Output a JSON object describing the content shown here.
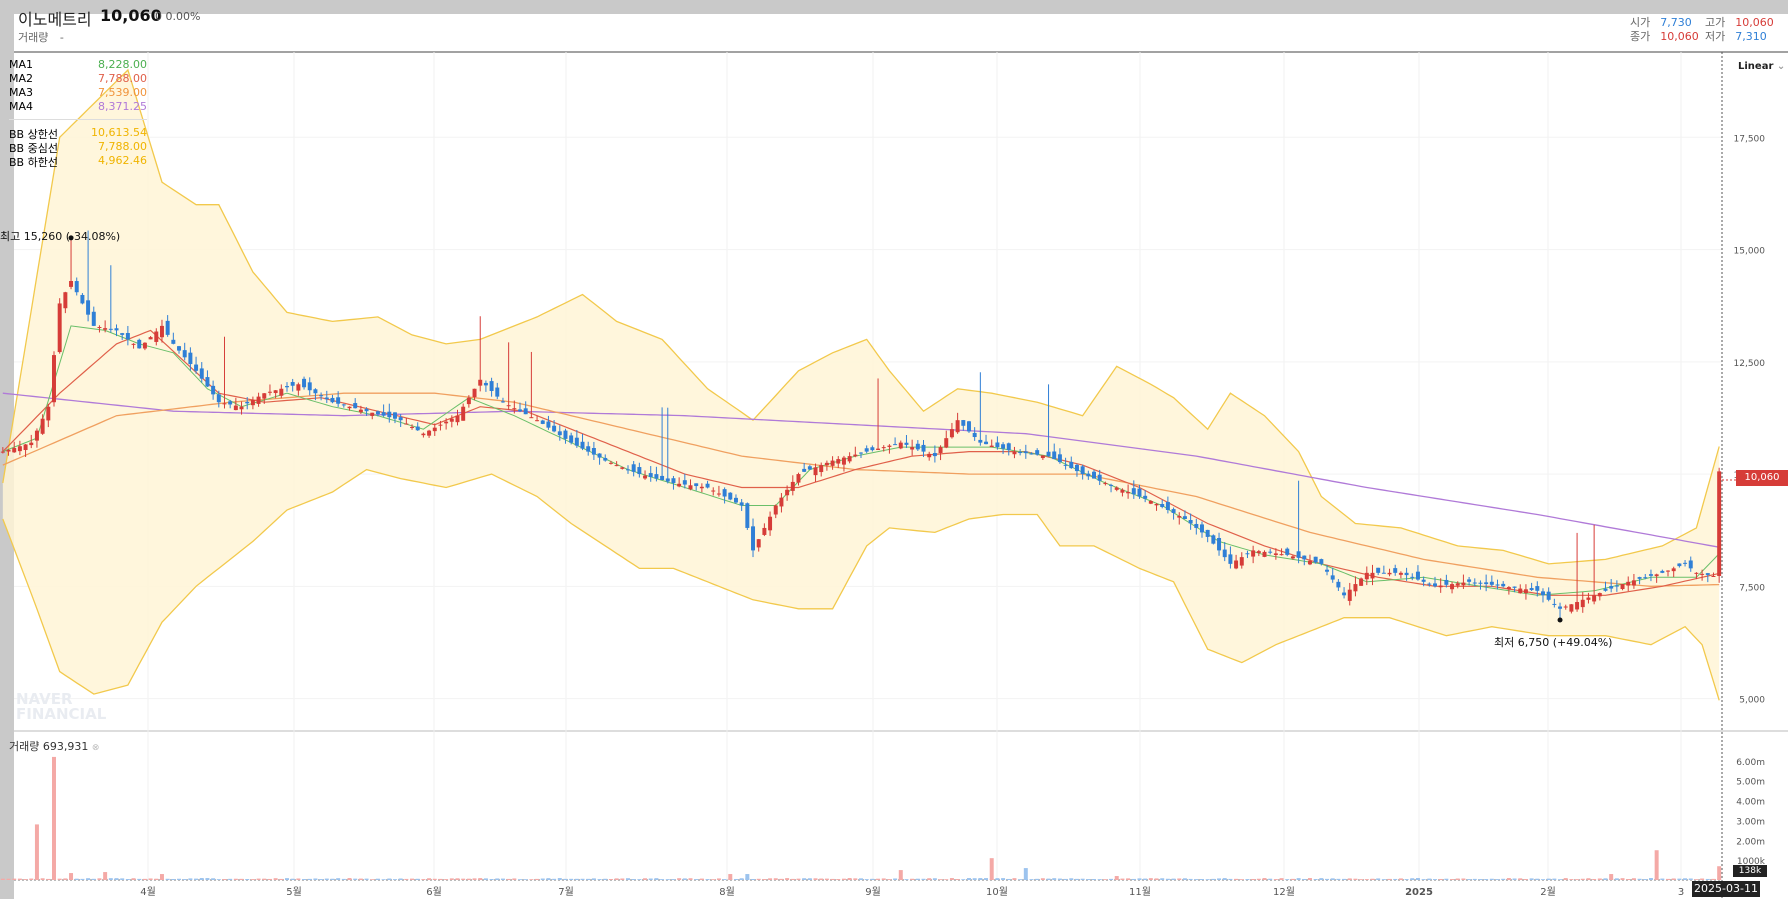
{
  "header": {
    "name": "이노메트리",
    "price": "10,060",
    "change": "0 0.00%",
    "volume_label": "거래량",
    "volume_value": "-"
  },
  "ohlc": {
    "open_label": "시가",
    "open": "7,730",
    "high_label": "고가",
    "high": "10,060",
    "close_label": "종가",
    "close": "10,060",
    "low_label": "저가",
    "low": "7,310"
  },
  "legend": {
    "ma": [
      {
        "name": "MA1",
        "value": "8,228.00",
        "color": "#4caf50"
      },
      {
        "name": "MA2",
        "value": "7,788.00",
        "color": "#e0604a"
      },
      {
        "name": "MA3",
        "value": "7,539.00",
        "color": "#f0943c"
      },
      {
        "name": "MA4",
        "value": "8,371.25",
        "color": "#b07ad8"
      }
    ],
    "bb": [
      {
        "name": "BB 상한선",
        "value": "10,613.54",
        "color": "#f2c037"
      },
      {
        "name": "BB 중심선",
        "value": "7,788.00",
        "color": "#f2c037"
      },
      {
        "name": "BB 하한선",
        "value": "4,962.46",
        "color": "#f2c037"
      }
    ]
  },
  "scale_mode": "Linear",
  "annotations": {
    "high": "최고 15,260 (-34.08%)",
    "low": "최저 6,750 (+49.04%)"
  },
  "watermark": [
    "NAVER",
    "FINANCIAL"
  ],
  "volume_panel": {
    "label": "거래량",
    "value": "693,931"
  },
  "current_price_tag": "10,060",
  "current_volume_tag": "138k",
  "crosshair_date": "2025-03-11",
  "colors": {
    "up": "#d63c38",
    "down": "#2f7fd6",
    "band_fill": "#fff5d6",
    "band_line": "#f2c94c"
  },
  "chart_data": {
    "type": "candlestick",
    "y_ticks": [
      "17,500",
      "15,000",
      "12,500",
      "10,000",
      "7,500",
      "5,000"
    ],
    "y_tick_values": [
      17500,
      15000,
      12500,
      10000,
      7500,
      5000
    ],
    "ylim": [
      4300,
      19400
    ],
    "x_labels": [
      "4월",
      "5월",
      "6월",
      "7월",
      "8월",
      "9월",
      "10월",
      "11월",
      "12월",
      "2025",
      "2월",
      "3"
    ],
    "volume_ticks": [
      "6.00m",
      "5.00m",
      "4.00m",
      "3.00m",
      "2.00m",
      "1000k"
    ],
    "volume_tick_values": [
      6000000,
      5000000,
      4000000,
      3000000,
      2000000,
      1000000
    ],
    "price_anchors": [
      [
        0,
        10500
      ],
      [
        5,
        10700
      ],
      [
        8,
        11500
      ],
      [
        10,
        13800
      ],
      [
        12,
        14300
      ],
      [
        14,
        13800
      ],
      [
        16,
        13300
      ],
      [
        20,
        13200
      ],
      [
        24,
        12800
      ],
      [
        28,
        13300
      ],
      [
        30,
        12900
      ],
      [
        34,
        12300
      ],
      [
        38,
        11600
      ],
      [
        42,
        11500
      ],
      [
        46,
        11800
      ],
      [
        52,
        12000
      ],
      [
        58,
        11600
      ],
      [
        64,
        11400
      ],
      [
        70,
        11200
      ],
      [
        74,
        10900
      ],
      [
        80,
        11300
      ],
      [
        84,
        12100
      ],
      [
        88,
        11600
      ],
      [
        94,
        11200
      ],
      [
        100,
        10700
      ],
      [
        106,
        10300
      ],
      [
        112,
        10000
      ],
      [
        118,
        9800
      ],
      [
        124,
        9700
      ],
      [
        130,
        9300
      ],
      [
        132,
        8300
      ],
      [
        136,
        9300
      ],
      [
        140,
        10000
      ],
      [
        146,
        10300
      ],
      [
        152,
        10500
      ],
      [
        158,
        10700
      ],
      [
        164,
        10400
      ],
      [
        168,
        11200
      ],
      [
        172,
        10700
      ],
      [
        178,
        10500
      ],
      [
        184,
        10400
      ],
      [
        190,
        10000
      ],
      [
        196,
        9700
      ],
      [
        202,
        9400
      ],
      [
        208,
        9000
      ],
      [
        212,
        8600
      ],
      [
        216,
        8000
      ],
      [
        220,
        8300
      ],
      [
        226,
        8200
      ],
      [
        232,
        8000
      ],
      [
        236,
        7300
      ],
      [
        240,
        7800
      ],
      [
        246,
        7800
      ],
      [
        252,
        7500
      ],
      [
        258,
        7600
      ],
      [
        264,
        7500
      ],
      [
        270,
        7400
      ],
      [
        274,
        7000
      ],
      [
        280,
        7300
      ],
      [
        286,
        7600
      ],
      [
        292,
        7800
      ],
      [
        296,
        8000
      ],
      [
        298,
        7800
      ],
      [
        301,
        7730
      ],
      [
        302,
        10060
      ]
    ],
    "ma1_anchors": [
      [
        0,
        10500
      ],
      [
        6,
        10800
      ],
      [
        12,
        13300
      ],
      [
        18,
        13200
      ],
      [
        24,
        12900
      ],
      [
        30,
        12700
      ],
      [
        36,
        11900
      ],
      [
        42,
        11500
      ],
      [
        50,
        11800
      ],
      [
        58,
        11500
      ],
      [
        66,
        11300
      ],
      [
        74,
        11000
      ],
      [
        82,
        11700
      ],
      [
        90,
        11300
      ],
      [
        100,
        10700
      ],
      [
        110,
        10100
      ],
      [
        120,
        9700
      ],
      [
        130,
        9300
      ],
      [
        136,
        9300
      ],
      [
        142,
        10100
      ],
      [
        150,
        10400
      ],
      [
        158,
        10600
      ],
      [
        166,
        10600
      ],
      [
        174,
        10600
      ],
      [
        184,
        10400
      ],
      [
        194,
        9800
      ],
      [
        204,
        9300
      ],
      [
        214,
        8500
      ],
      [
        222,
        8200
      ],
      [
        232,
        8000
      ],
      [
        240,
        7600
      ],
      [
        250,
        7700
      ],
      [
        260,
        7500
      ],
      [
        270,
        7300
      ],
      [
        280,
        7400
      ],
      [
        290,
        7700
      ],
      [
        298,
        7700
      ],
      [
        302,
        8228
      ]
    ],
    "ma2_anchors": [
      [
        0,
        10500
      ],
      [
        10,
        11800
      ],
      [
        20,
        12900
      ],
      [
        26,
        13200
      ],
      [
        32,
        12500
      ],
      [
        38,
        11800
      ],
      [
        46,
        11600
      ],
      [
        56,
        11700
      ],
      [
        66,
        11400
      ],
      [
        76,
        11100
      ],
      [
        84,
        11500
      ],
      [
        92,
        11400
      ],
      [
        100,
        11000
      ],
      [
        110,
        10500
      ],
      [
        120,
        10000
      ],
      [
        130,
        9700
      ],
      [
        140,
        9700
      ],
      [
        150,
        10100
      ],
      [
        160,
        10400
      ],
      [
        170,
        10500
      ],
      [
        180,
        10500
      ],
      [
        190,
        10200
      ],
      [
        200,
        9700
      ],
      [
        212,
        8900
      ],
      [
        222,
        8400
      ],
      [
        232,
        8000
      ],
      [
        242,
        7700
      ],
      [
        252,
        7500
      ],
      [
        262,
        7500
      ],
      [
        272,
        7300
      ],
      [
        282,
        7300
      ],
      [
        292,
        7500
      ],
      [
        302,
        7788
      ]
    ],
    "ma3_anchors": [
      [
        0,
        10200
      ],
      [
        20,
        11300
      ],
      [
        40,
        11600
      ],
      [
        60,
        11800
      ],
      [
        76,
        11800
      ],
      [
        90,
        11600
      ],
      [
        110,
        11000
      ],
      [
        130,
        10400
      ],
      [
        150,
        10100
      ],
      [
        170,
        10000
      ],
      [
        190,
        10000
      ],
      [
        210,
        9500
      ],
      [
        230,
        8700
      ],
      [
        250,
        8100
      ],
      [
        270,
        7700
      ],
      [
        290,
        7500
      ],
      [
        302,
        7539
      ]
    ],
    "ma4_anchors": [
      [
        0,
        11800
      ],
      [
        30,
        11400
      ],
      [
        60,
        11300
      ],
      [
        90,
        11400
      ],
      [
        120,
        11300
      ],
      [
        150,
        11100
      ],
      [
        180,
        10900
      ],
      [
        210,
        10400
      ],
      [
        240,
        9700
      ],
      [
        270,
        9100
      ],
      [
        302,
        8371
      ]
    ],
    "bb_upper_anchors": [
      [
        0,
        9800
      ],
      [
        10,
        17500
      ],
      [
        22,
        19000
      ],
      [
        28,
        16500
      ],
      [
        34,
        16000
      ],
      [
        38,
        16000
      ],
      [
        44,
        14500
      ],
      [
        50,
        13600
      ],
      [
        58,
        13400
      ],
      [
        66,
        13500
      ],
      [
        72,
        13100
      ],
      [
        78,
        12900
      ],
      [
        84,
        13000
      ],
      [
        94,
        13500
      ],
      [
        102,
        14000
      ],
      [
        108,
        13400
      ],
      [
        116,
        13000
      ],
      [
        124,
        11900
      ],
      [
        132,
        11200
      ],
      [
        140,
        12300
      ],
      [
        146,
        12700
      ],
      [
        152,
        13000
      ],
      [
        156,
        12300
      ],
      [
        162,
        11400
      ],
      [
        168,
        11900
      ],
      [
        174,
        11800
      ],
      [
        182,
        11600
      ],
      [
        190,
        11300
      ],
      [
        196,
        12400
      ],
      [
        202,
        12000
      ],
      [
        206,
        11700
      ],
      [
        212,
        11000
      ],
      [
        216,
        11800
      ],
      [
        222,
        11300
      ],
      [
        228,
        10500
      ],
      [
        232,
        9500
      ],
      [
        238,
        8900
      ],
      [
        246,
        8800
      ],
      [
        256,
        8400
      ],
      [
        264,
        8300
      ],
      [
        272,
        8000
      ],
      [
        282,
        8100
      ],
      [
        292,
        8400
      ],
      [
        298,
        8800
      ],
      [
        302,
        10614
      ]
    ],
    "bb_lower_anchors": [
      [
        0,
        9000
      ],
      [
        6,
        7000
      ],
      [
        10,
        5600
      ],
      [
        16,
        5100
      ],
      [
        22,
        5300
      ],
      [
        28,
        6700
      ],
      [
        34,
        7500
      ],
      [
        38,
        7900
      ],
      [
        44,
        8500
      ],
      [
        50,
        9200
      ],
      [
        58,
        9600
      ],
      [
        64,
        10100
      ],
      [
        70,
        9900
      ],
      [
        78,
        9700
      ],
      [
        86,
        10000
      ],
      [
        94,
        9500
      ],
      [
        100,
        8900
      ],
      [
        106,
        8400
      ],
      [
        112,
        7900
      ],
      [
        118,
        7900
      ],
      [
        124,
        7600
      ],
      [
        132,
        7200
      ],
      [
        140,
        7000
      ],
      [
        146,
        7000
      ],
      [
        152,
        8400
      ],
      [
        156,
        8800
      ],
      [
        164,
        8700
      ],
      [
        170,
        9000
      ],
      [
        176,
        9100
      ],
      [
        182,
        9100
      ],
      [
        186,
        8400
      ],
      [
        192,
        8400
      ],
      [
        200,
        7900
      ],
      [
        206,
        7600
      ],
      [
        212,
        6100
      ],
      [
        218,
        5800
      ],
      [
        224,
        6200
      ],
      [
        230,
        6500
      ],
      [
        236,
        6800
      ],
      [
        244,
        6800
      ],
      [
        254,
        6400
      ],
      [
        262,
        6600
      ],
      [
        272,
        6400
      ],
      [
        282,
        6400
      ],
      [
        290,
        6200
      ],
      [
        296,
        6600
      ],
      [
        299,
        6200
      ],
      [
        302,
        4962
      ]
    ],
    "candle_count": 303,
    "volume_spikes": [
      [
        6,
        2800000,
        "up"
      ],
      [
        9,
        6200000,
        "up"
      ],
      [
        12,
        350000,
        "up"
      ],
      [
        18,
        400000,
        "up"
      ],
      [
        28,
        300000,
        "up"
      ],
      [
        128,
        300000,
        "up"
      ],
      [
        131,
        300000,
        "down"
      ],
      [
        158,
        500000,
        "up"
      ],
      [
        174,
        1100000,
        "up"
      ],
      [
        180,
        600000,
        "down"
      ],
      [
        196,
        200000,
        "up"
      ],
      [
        283,
        300000,
        "up"
      ],
      [
        291,
        1500000,
        "up"
      ],
      [
        302,
        693931,
        "up"
      ]
    ]
  }
}
